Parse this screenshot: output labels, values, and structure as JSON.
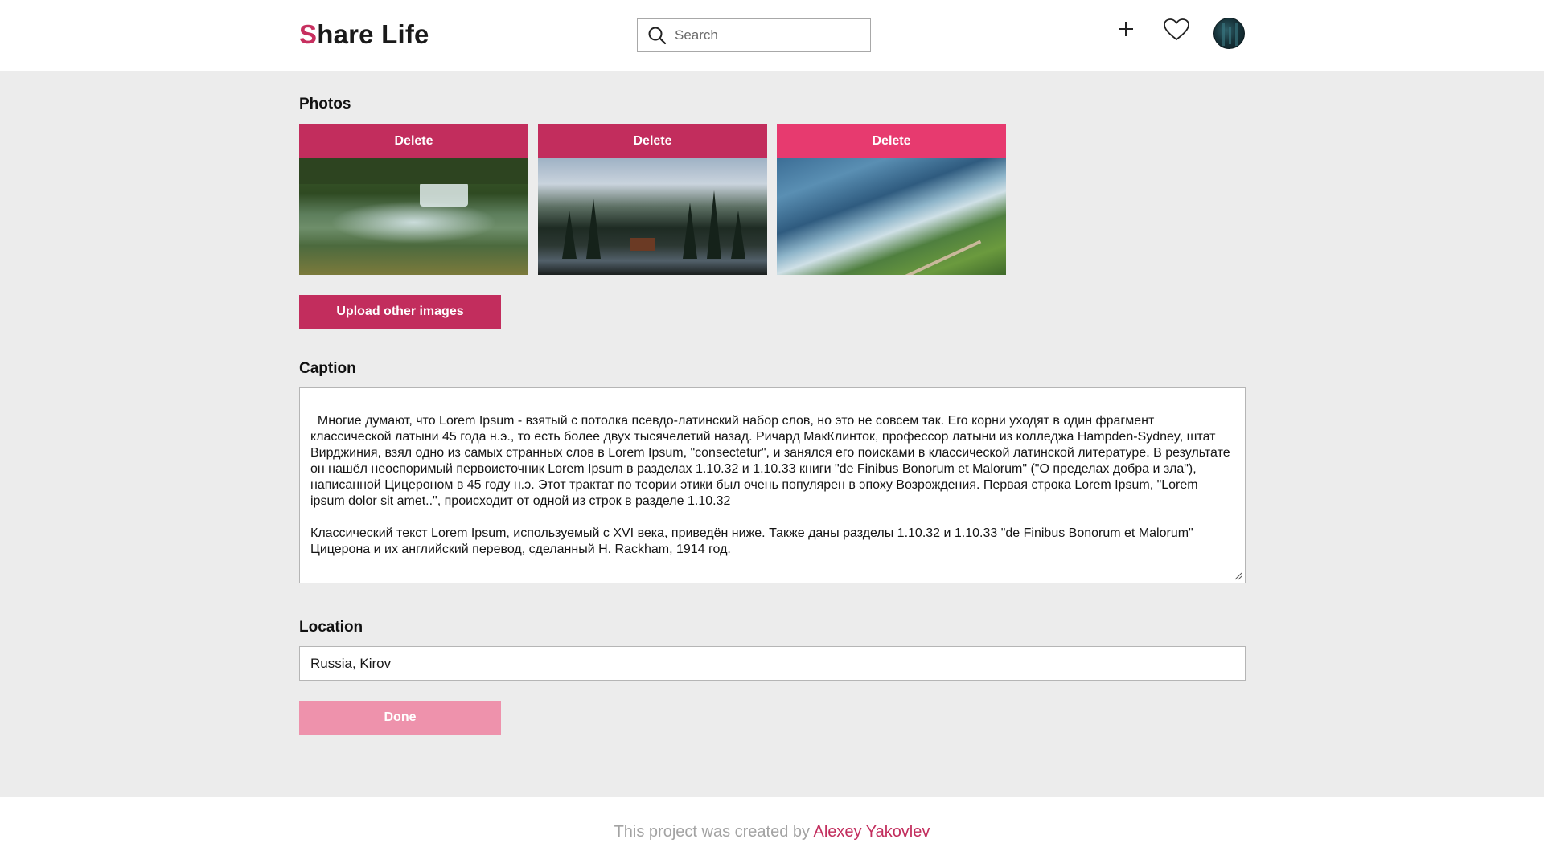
{
  "header": {
    "logo_first_letter": "S",
    "logo_rest": "hare Life",
    "search_placeholder": "Search",
    "icons": [
      "plus-icon",
      "heart-icon",
      "avatar"
    ]
  },
  "photos": {
    "title": "Photos",
    "items": [
      {
        "delete_label": "Delete",
        "button_color": "#c22d5d",
        "scene": "waterfall in forest"
      },
      {
        "delete_label": "Delete",
        "button_color": "#c22d5d",
        "scene": "mountain lake with pine trees"
      },
      {
        "delete_label": "Delete",
        "button_color": "#e73a6f",
        "scene": "fjord with green valley"
      }
    ],
    "upload_label": "Upload other images"
  },
  "caption": {
    "title": "Caption",
    "text": "Многие думают, что Lorem Ipsum - взятый с потолка псевдо-латинский набор слов, но это не совсем так. Его корни уходят в один фрагмент классической латыни 45 года н.э., то есть более двух тысячелетий назад. Ричард МакКлинток, профессор латыни из колледжа Hampden-Sydney, штат Вирджиния, взял одно из самых странных слов в Lorem Ipsum, \"consectetur\", и занялся его поисками в классической латинской литературе. В результате он нашёл неоспоримый первоисточник Lorem Ipsum в разделах 1.10.32 и 1.10.33 книги \"de Finibus Bonorum et Malorum\" (\"О пределах добра и зла\"), написанной Цицероном в 45 году н.э. Этот трактат по теории этики был очень популярен в эпоху Возрождения. Первая строка Lorem Ipsum, \"Lorem ipsum dolor sit amet..\", происходит от одной из строк в разделе 1.10.32\n\nКлассический текст Lorem Ipsum, используемый с XVI века, приведён ниже. Также даны разделы 1.10.32 и 1.10.33 \"de Finibus Bonorum et Malorum\" Цицерона и их английский перевод, сделанный H. Rackham, 1914 год."
  },
  "location": {
    "title": "Location",
    "value": "Russia, Kirov"
  },
  "done_label": "Done",
  "footer": {
    "text": "This project was created by ",
    "author": "Alexey Yakovlev"
  },
  "colors": {
    "accent": "#c22d5d",
    "accent_light": "#ee92ac",
    "background": "#ececec"
  }
}
